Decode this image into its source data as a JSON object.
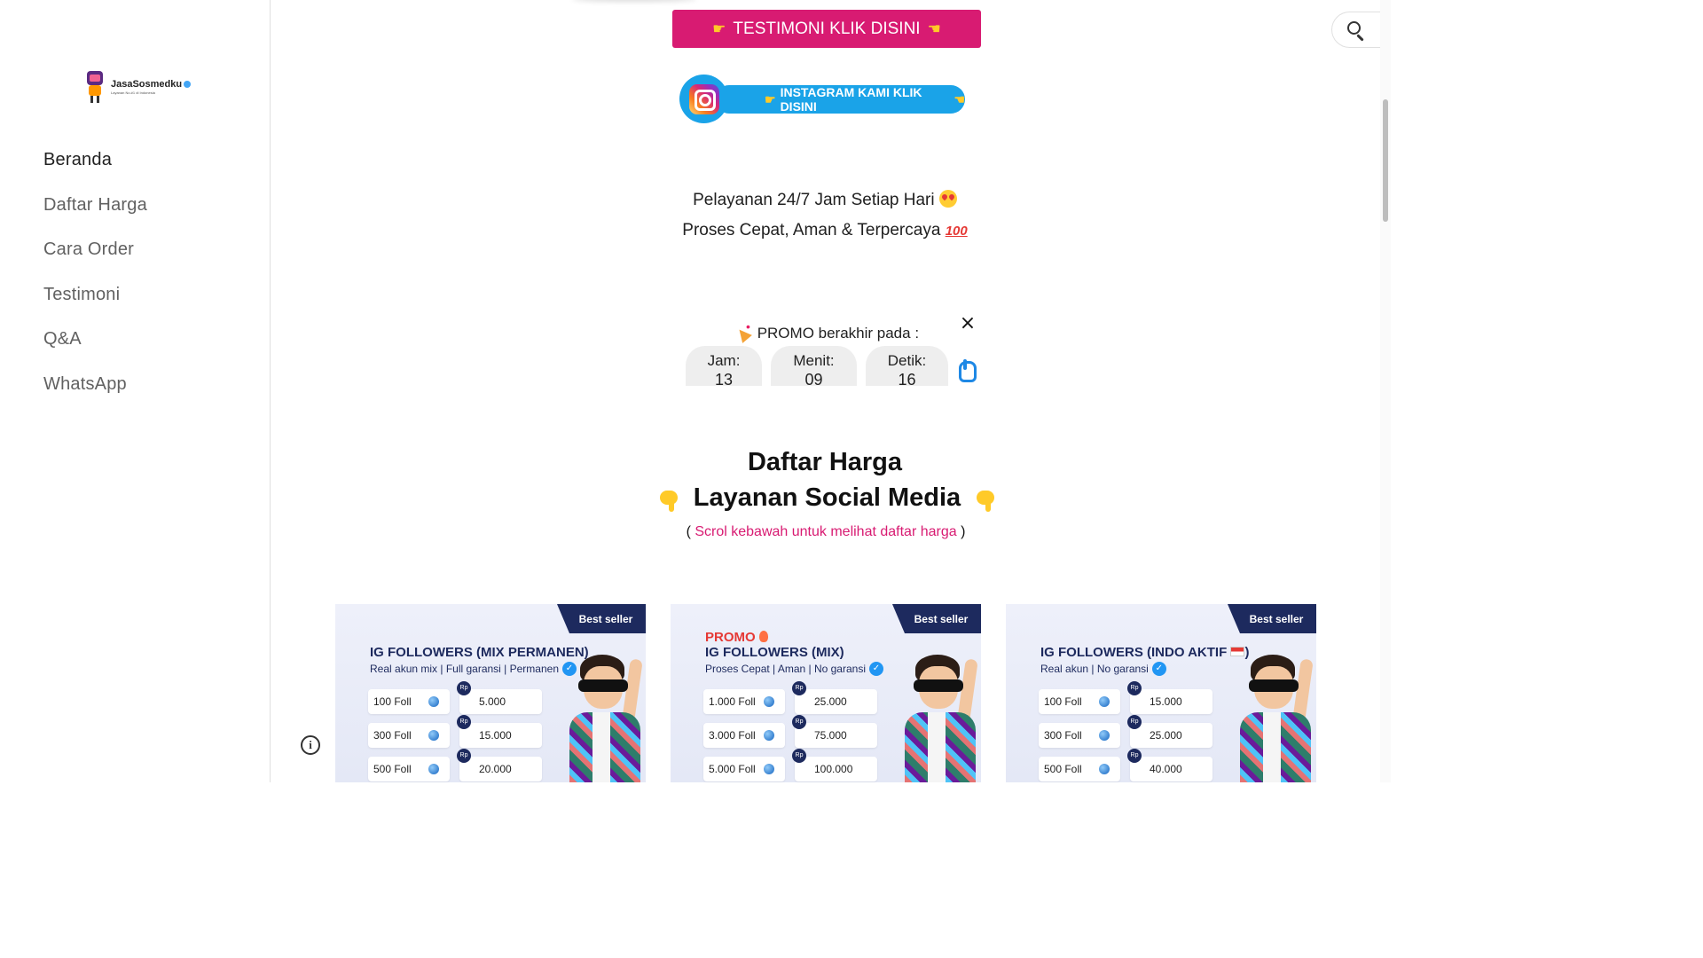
{
  "sidebar": {
    "logo_text": "JasaSosmedku",
    "logo_sub": "Layanan No.#1 di Indonesia",
    "nav": [
      "Beranda",
      "Daftar Harga",
      "Cara Order",
      "Testimoni",
      "Q&A",
      "WhatsApp"
    ],
    "active_item": "Beranda"
  },
  "buttons": {
    "testimoni": "TESTIMONI KLIK DISINI",
    "instagram": "INSTAGRAM KAMI KLIK DISINI"
  },
  "service": {
    "line1": "Pelayanan 24/7 Jam Setiap Hari",
    "line2": "Proses Cepat, Aman  & Terpercaya"
  },
  "promo": {
    "title": "PROMO berakhir pada :",
    "close": "×",
    "timer": [
      {
        "label": "Jam:",
        "value": "13"
      },
      {
        "label": "Menit:",
        "value": "09"
      },
      {
        "label": "Detik:",
        "value": "16"
      }
    ]
  },
  "pricing": {
    "title1": "Daftar Harga",
    "title2": "Layanan Social Media",
    "note_open": "(",
    "note_text": "Scrol kebawah untuk melihat daftar harga",
    "note_close": ")"
  },
  "cards": [
    {
      "badge": "Best seller",
      "promo": "",
      "title": "IG FOLLOWERS (MIX PERMANEN)",
      "subtitle": "Real akun mix | Full garansi | Permanen",
      "rows": [
        {
          "qty": "100 Foll",
          "price": "5.000"
        },
        {
          "qty": "300 Foll",
          "price": "15.000"
        },
        {
          "qty": "500 Foll",
          "price": "20.000"
        }
      ]
    },
    {
      "badge": "Best seller",
      "promo": "PROMO",
      "title": "IG FOLLOWERS (MIX)",
      "subtitle": "Proses Cepat | Aman | No garansi",
      "rows": [
        {
          "qty": "1.000 Foll",
          "price": "25.000"
        },
        {
          "qty": "3.000 Foll",
          "price": "75.000"
        },
        {
          "qty": "5.000 Foll",
          "price": "100.000"
        }
      ]
    },
    {
      "badge": "Best seller",
      "promo": "",
      "title": "IG FOLLOWERS (INDO AKTIF",
      "title_end": ")",
      "subtitle": "Real akun | No garansi",
      "rows": [
        {
          "qty": "100 Foll",
          "price": "15.000"
        },
        {
          "qty": "300 Foll",
          "price": "25.000"
        },
        {
          "qty": "500 Foll",
          "price": "40.000"
        }
      ]
    }
  ],
  "currency_badge": "Rp",
  "controls": {
    "info_label": "i"
  },
  "colors": {
    "accent_pink": "#d81b72",
    "instagram_blue": "#1aa3e8",
    "card_navy": "#1d2a5e"
  }
}
